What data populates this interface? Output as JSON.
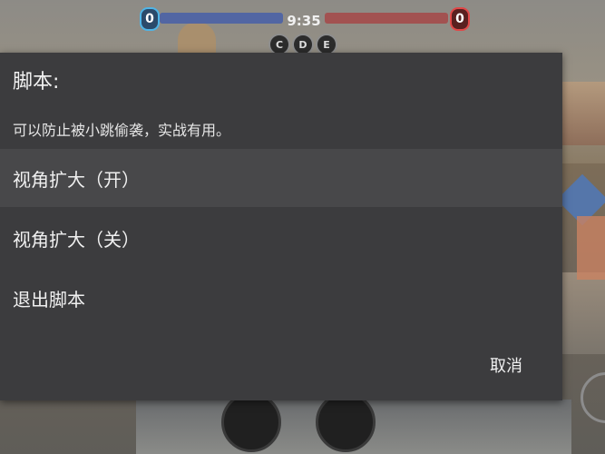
{
  "hud": {
    "blue_score": "0",
    "red_score": "0",
    "timer": "9:35",
    "points": [
      "C",
      "D",
      "E"
    ]
  },
  "dialog": {
    "title": "脚本:",
    "message": "可以防止被小跳偷袭，实战有用。",
    "options": [
      {
        "label": "视角扩大（开）",
        "selected": true
      },
      {
        "label": "视角扩大（关）",
        "selected": false
      },
      {
        "label": "退出脚本",
        "selected": false
      }
    ],
    "cancel_label": "取消"
  },
  "colors": {
    "dialog_bg": "#3c3c3e",
    "selected_row": "#48484a",
    "blue_team": "#4b62a6",
    "red_team": "#a44b4b"
  }
}
